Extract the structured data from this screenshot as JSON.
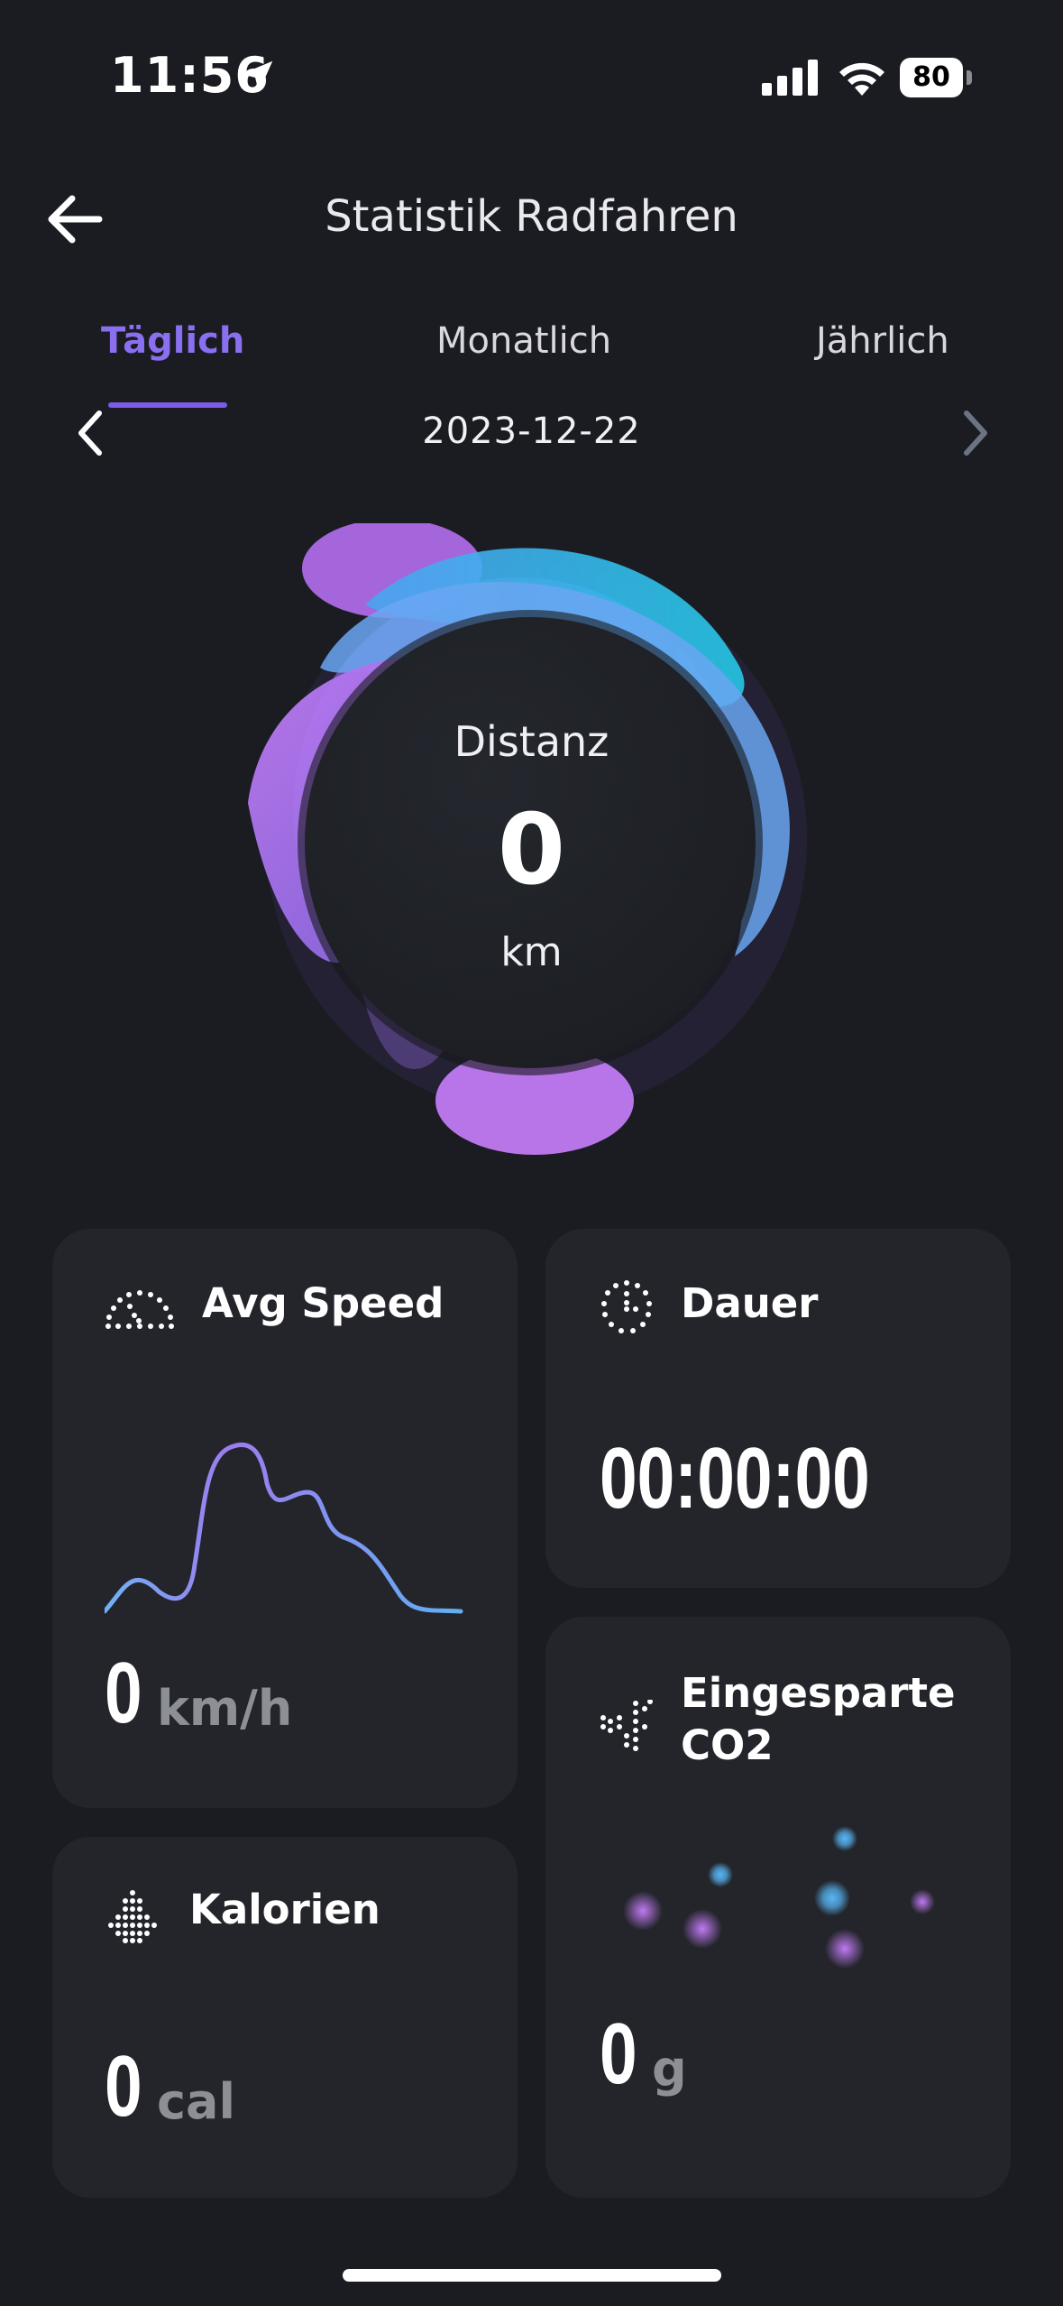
{
  "status_bar": {
    "time": "11:56",
    "battery": "80"
  },
  "header": {
    "title": "Statistik Radfahren"
  },
  "tabs": [
    {
      "label": "Täglich",
      "active": true
    },
    {
      "label": "Monatlich",
      "active": false
    },
    {
      "label": "Jährlich",
      "active": false
    }
  ],
  "date_nav": {
    "date": "2023-12-22"
  },
  "distance": {
    "label": "Distanz",
    "value": "0",
    "unit": "km"
  },
  "cards": {
    "avg_speed": {
      "title": "Avg Speed",
      "value": "0",
      "unit": "km/h"
    },
    "duration": {
      "title": "Dauer",
      "value": "00:00:00"
    },
    "calories": {
      "title": "Kalorien",
      "value": "0",
      "unit": "cal"
    },
    "co2": {
      "title_line1": "Eingesparte",
      "title_line2": "CO2",
      "value": "0",
      "unit": "g"
    }
  },
  "colors": {
    "background": "#1b1c22",
    "card": "#23252b",
    "accent": "#8a70f0"
  },
  "icons": [
    "location-arrow-icon",
    "cellular-signal-icon",
    "wifi-icon",
    "battery-icon",
    "back-arrow-icon",
    "chevron-left-icon",
    "chevron-right-icon",
    "speedometer-icon",
    "clock-icon",
    "calories-icon",
    "co2-icon"
  ]
}
